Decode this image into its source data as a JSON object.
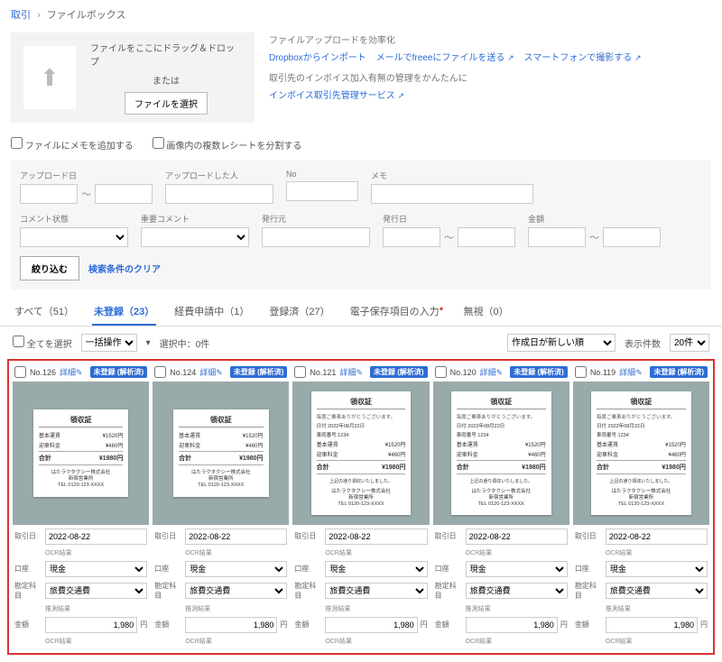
{
  "breadcrumb": {
    "root": "取引",
    "current": "ファイルボックス"
  },
  "dropzone": {
    "text1": "ファイルをここにドラッグ＆ドロップ",
    "text2": "または",
    "button": "ファイルを選択"
  },
  "links": {
    "heading1": "ファイルアップロードを効率化",
    "l1": "Dropboxからインポート",
    "l2": "メールでfreeeにファイルを送る",
    "l3": "スマートフォンで撮影する",
    "heading2": "取引先のインボイス加入有無の管理をかんたんに",
    "l4": "インボイス取引先管理サービス"
  },
  "checks": {
    "c1": "ファイルにメモを追加する",
    "c2": "画像内の複数レシートを分割する"
  },
  "filters": {
    "f_upload": "アップロード日",
    "f_uploader": "アップロードした人",
    "f_no": "No",
    "f_memo": "メモ",
    "f_cstat": "コメント状態",
    "f_important": "重要コメント",
    "f_issuer": "発行元",
    "f_issued": "発行日",
    "f_amount": "金額",
    "btn_apply": "絞り込む",
    "btn_clear": "検索条件のクリア"
  },
  "tabs": {
    "all": "すべて（51）",
    "unreg": "未登録（23）",
    "expense": "経費申請中（1）",
    "reg": "登録済（27）",
    "einput": "電子保存項目の入力",
    "ignored": "無視（0）"
  },
  "listbar": {
    "selall": "全てを選択",
    "bulk": "一括操作",
    "selcount": "選択中：0件",
    "sort": "作成日が新しい順",
    "disp": "表示件数",
    "per": "20件"
  },
  "common": {
    "detail": "詳細",
    "badge": "未登録 (解析済)",
    "m_date": "取引日",
    "m_ocr": "OCR結果",
    "m_type": "口座",
    "m_cash": "現金",
    "m_account": "勘定科目",
    "m_travel": "旅費交通費",
    "m_infer": "推測結果",
    "m_amount": "金額",
    "yen": "円"
  },
  "receipt": {
    "title": "領収証",
    "thanks": "毎度ご乗車ありがとうございます。",
    "dateline": "日付 2022年08月22日",
    "car": "車両番号 1234",
    "fare_l": "基本運賃",
    "fare_v": "¥1520円",
    "extra_l": "迎車料金",
    "extra_v": "¥460円",
    "total_l": "合計",
    "total_v": "¥1980円",
    "note": "上記の通り領収いたしました。",
    "co1": "はたラクタクシー株式会社",
    "co2": "新宿営業所",
    "co3": "TEL 0120-123-XXXX"
  },
  "cards": [
    {
      "no": "No.126",
      "date": "2022-08-22",
      "amount": "1,980",
      "tall": false
    },
    {
      "no": "No.124",
      "date": "2022-08-22",
      "amount": "1,980",
      "tall": false
    },
    {
      "no": "No.121",
      "date": "2022-08-22",
      "amount": "1,980",
      "tall": true
    },
    {
      "no": "No.120",
      "date": "2022-08-22",
      "amount": "1,980",
      "tall": true
    },
    {
      "no": "No.119",
      "date": "2022-08-22",
      "amount": "1,980",
      "tall": true
    }
  ]
}
